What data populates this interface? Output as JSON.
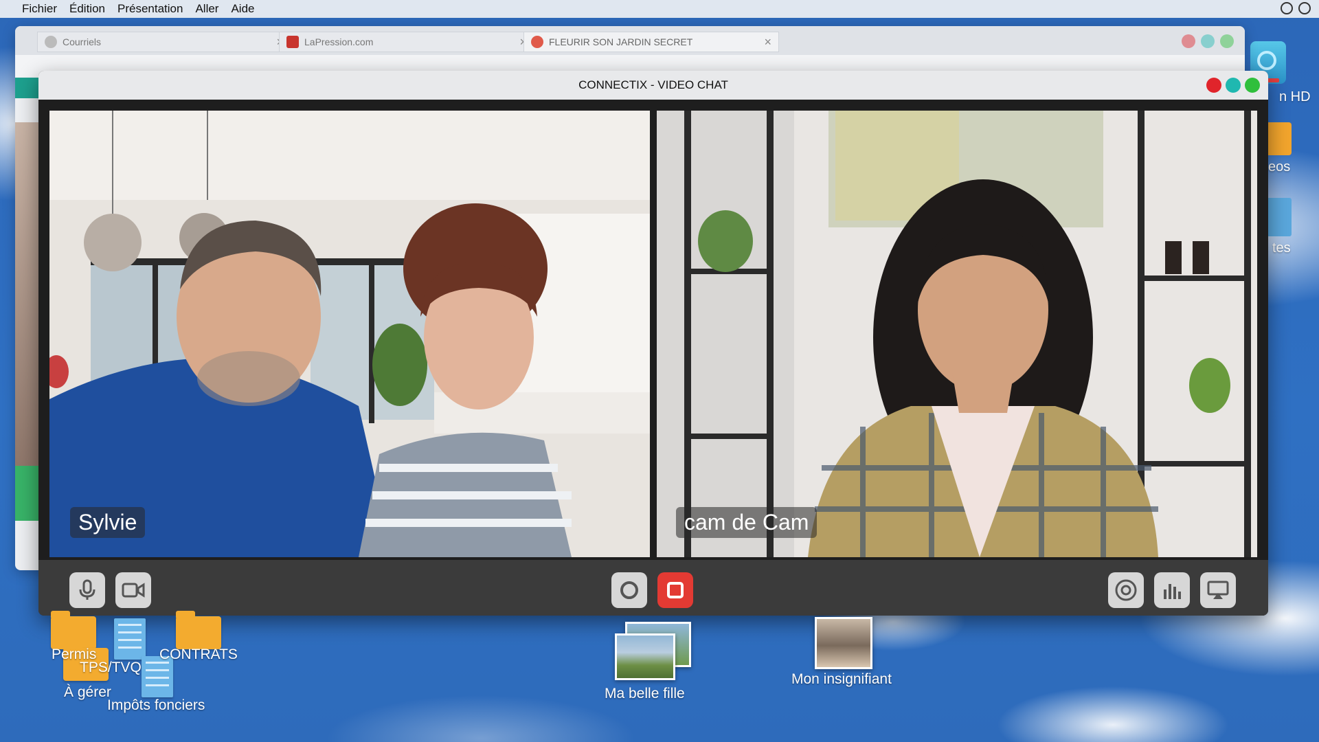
{
  "menubar": {
    "items": [
      "Fichier",
      "Édition",
      "Présentation",
      "Aller",
      "Aide"
    ]
  },
  "browser": {
    "tabs": [
      {
        "label": "Courriels"
      },
      {
        "label": "LaPression.com"
      },
      {
        "label": "FLEURIR SON JARDIN SECRET"
      }
    ]
  },
  "desktop_right": {
    "labels": [
      "n HD",
      "eos",
      "tes"
    ]
  },
  "video_chat": {
    "title": "CONNECTIX - VIDEO CHAT",
    "participants": [
      {
        "name": "Sylvie"
      },
      {
        "name": "cam de Cam"
      }
    ],
    "controls": {
      "left": [
        "microphone-icon",
        "camera-icon"
      ],
      "center": [
        "record-icon",
        "stop-icon"
      ],
      "right": [
        "broadcast-icon",
        "stats-icon",
        "airplay-icon"
      ]
    },
    "colors": {
      "close": "#e0242b",
      "minimize": "#1fb8b0",
      "maximize": "#2fbf3c",
      "stop": "#e33a33"
    }
  },
  "desktop": {
    "icons": [
      {
        "label": "Permis"
      },
      {
        "label": "TPS/TVQ"
      },
      {
        "label": "CONTRATS"
      },
      {
        "label": "À gérer"
      },
      {
        "label": "Impôts fonciers"
      },
      {
        "label": "Ma belle fille"
      },
      {
        "label": "Mon insignifiant"
      }
    ]
  }
}
